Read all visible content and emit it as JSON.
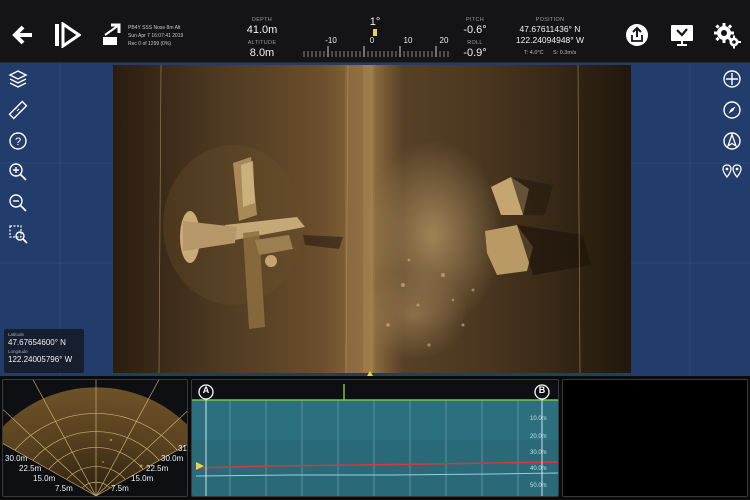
{
  "toolbar": {
    "file_name": "PB4Y SSS Nose 8m Alt",
    "date": "Sun Apr 7 16:07:41 2019",
    "record": "Rec 0 of 1299 (0%)",
    "depth_label": "DEPTH",
    "depth_value": "41.0m",
    "altitude_label": "ALTITUDE",
    "altitude_value": "8.0m",
    "heading_value": "1°",
    "heading_ticks": [
      "-10",
      "0",
      "10",
      "20"
    ],
    "pitch_label": "PITCH",
    "pitch_value": "-0.6°",
    "roll_label": "ROLL",
    "roll_value": "-0.9°",
    "position_label": "POSITION",
    "latitude": "47.67611436° N",
    "longitude": "122.24094948° W",
    "temperature": "T: 4.0°C",
    "speed": "S: 0.3m/s",
    "icons": {
      "back": "back-arrow-icon",
      "play": "play-icon",
      "speed": "playback-speed-icon",
      "share": "share-icon",
      "display": "display-settings-icon",
      "settings": "gear-icon"
    }
  },
  "coords": {
    "lat_label": "Latitude",
    "lat_value": "47.67654600° N",
    "lon_label": "Longitude",
    "lon_value": "122.24005796° W"
  },
  "fan": {
    "range_labels": [
      "30.0m",
      "22.5m",
      "15.0m",
      "7.5m"
    ],
    "range_labels_right": [
      "30.0m",
      "22.5m",
      "15.0m",
      "7.5m"
    ],
    "edge_number": "31"
  },
  "profile": {
    "marker_a": "A",
    "marker_b": "B",
    "depth_ticks": [
      "10.0m",
      "20.0m",
      "30.0m",
      "40.0m",
      "50.0m"
    ]
  },
  "colors": {
    "toolbar_bg": "#141416",
    "map_bg": "#223c6c",
    "sonar_tone": "#b48a4a",
    "profile_bg": "#2a6a78",
    "depth_line": "#d03a3a",
    "bottom_line": "#8fd2e6",
    "accent_green": "#7cc24a",
    "marker_yellow": "#e8d44a"
  }
}
